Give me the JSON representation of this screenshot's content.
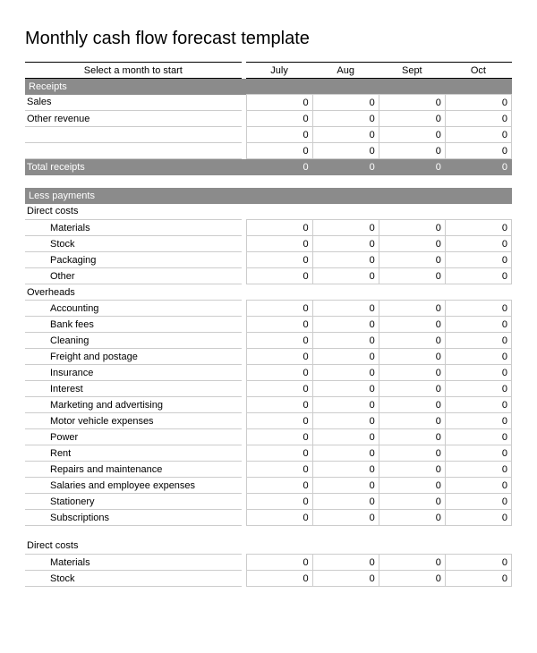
{
  "title": "Monthly cash flow forecast template",
  "header": {
    "select_label": "Select a month to start",
    "months": [
      "July",
      "Aug",
      "Sept",
      "Oct"
    ]
  },
  "receipts": {
    "heading": "Receipts",
    "rows": [
      {
        "label": "Sales",
        "values": [
          "0",
          "0",
          "0",
          "0"
        ]
      },
      {
        "label": "Other revenue",
        "values": [
          "0",
          "0",
          "0",
          "0"
        ]
      },
      {
        "label": "",
        "values": [
          "0",
          "0",
          "0",
          "0"
        ]
      },
      {
        "label": "",
        "values": [
          "0",
          "0",
          "0",
          "0"
        ]
      }
    ],
    "total_label": "Total receipts",
    "total_values": [
      "0",
      "0",
      "0",
      "0"
    ]
  },
  "less_payments": {
    "heading": "Less payments",
    "groups": [
      {
        "label": "Direct costs",
        "rows": [
          {
            "label": "Materials",
            "values": [
              "0",
              "0",
              "0",
              "0"
            ]
          },
          {
            "label": "Stock",
            "values": [
              "0",
              "0",
              "0",
              "0"
            ]
          },
          {
            "label": "Packaging",
            "values": [
              "0",
              "0",
              "0",
              "0"
            ]
          },
          {
            "label": "Other",
            "values": [
              "0",
              "0",
              "0",
              "0"
            ]
          }
        ]
      },
      {
        "label": "Overheads",
        "rows": [
          {
            "label": "Accounting",
            "values": [
              "0",
              "0",
              "0",
              "0"
            ]
          },
          {
            "label": "Bank fees",
            "values": [
              "0",
              "0",
              "0",
              "0"
            ]
          },
          {
            "label": "Cleaning",
            "values": [
              "0",
              "0",
              "0",
              "0"
            ]
          },
          {
            "label": "Freight and postage",
            "values": [
              "0",
              "0",
              "0",
              "0"
            ]
          },
          {
            "label": "Insurance",
            "values": [
              "0",
              "0",
              "0",
              "0"
            ]
          },
          {
            "label": "Interest",
            "values": [
              "0",
              "0",
              "0",
              "0"
            ]
          },
          {
            "label": "Marketing and advertising",
            "values": [
              "0",
              "0",
              "0",
              "0"
            ]
          },
          {
            "label": "Motor vehicle expenses",
            "values": [
              "0",
              "0",
              "0",
              "0"
            ]
          },
          {
            "label": "Power",
            "values": [
              "0",
              "0",
              "0",
              "0"
            ]
          },
          {
            "label": "Rent",
            "values": [
              "0",
              "0",
              "0",
              "0"
            ]
          },
          {
            "label": "Repairs and maintenance",
            "values": [
              "0",
              "0",
              "0",
              "0"
            ]
          },
          {
            "label": "Salaries and employee expenses",
            "values": [
              "0",
              "0",
              "0",
              "0"
            ]
          },
          {
            "label": "Stationery",
            "values": [
              "0",
              "0",
              "0",
              "0"
            ]
          },
          {
            "label": "Subscriptions",
            "values": [
              "0",
              "0",
              "0",
              "0"
            ]
          }
        ]
      },
      {
        "label": "Direct costs",
        "rows": [
          {
            "label": "Materials",
            "values": [
              "0",
              "0",
              "0",
              "0"
            ]
          },
          {
            "label": "Stock",
            "values": [
              "0",
              "0",
              "0",
              "0"
            ]
          }
        ]
      }
    ]
  }
}
